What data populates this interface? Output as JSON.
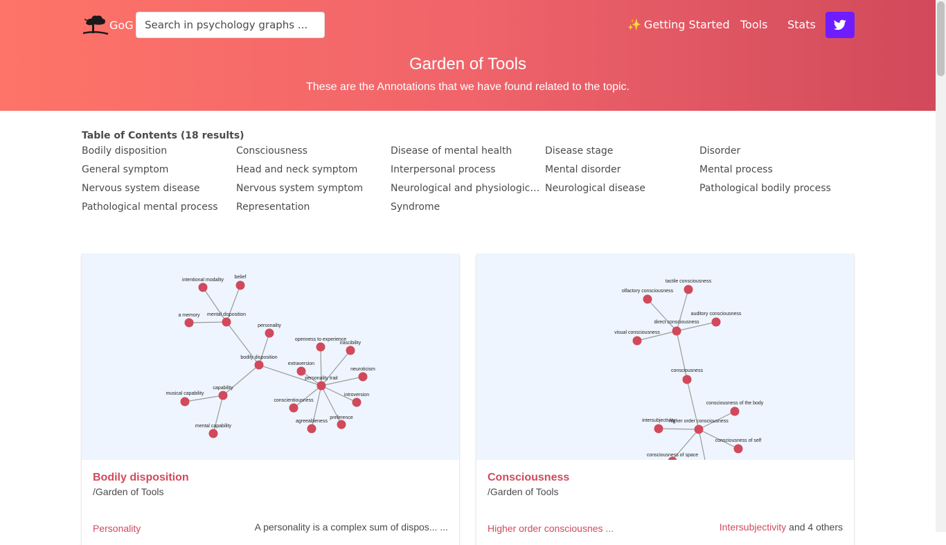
{
  "header": {
    "brand": "GoG",
    "search_placeholder": "Search in psychology graphs ...",
    "nav": {
      "getting_started": "Getting Started",
      "tools": "Tools",
      "stats": "Stats"
    },
    "icons": {
      "logo": "tree-logo-icon",
      "sparkle": "sparkle-icon",
      "twitter": "twitter-icon"
    },
    "sparkle_glyph": "✨"
  },
  "hero": {
    "title": "Garden of Tools",
    "subtitle": "These are the Annotations that we have found related to the topic."
  },
  "toc": {
    "title": "Table of Contents (18 results)",
    "items": [
      "Bodily disposition",
      "Consciousness",
      "Disease of mental health",
      "Disease stage",
      "Disorder",
      "General symptom",
      "Head and neck symptom",
      "Interpersonal process",
      "Mental disorder",
      "Mental process",
      "Nervous system disease",
      "Nervous system symptom",
      "Neurological and physiological s...",
      "Neurological disease",
      "Pathological bodily process",
      "Pathological mental process",
      "Representation",
      "Syndrome"
    ]
  },
  "cards": [
    {
      "title": "Bodily disposition",
      "subtitle": "/Garden of Tools",
      "link": "Personality",
      "right_text": "A personality is a complex sum of dispos... ...",
      "graph": {
        "node_labels": [
          "intentional modality",
          "belief",
          "a memory",
          "mental disposition",
          "personality",
          "bodily disposition",
          "openness to experience",
          "irascibility",
          "extraversion",
          "personality trait",
          "neuroticism",
          "musical capability",
          "capability",
          "conscientiousness",
          "introversion",
          "preference",
          "agreeableness",
          "mental capability"
        ]
      }
    },
    {
      "title": "Consciousness",
      "subtitle": "/Garden of Tools",
      "link": "Higher order consciousnes ...",
      "right_link": "Intersubjectivity",
      "right_text": " and 4 others",
      "graph": {
        "node_labels": [
          "tactile consciousness",
          "olfactory consciousness",
          "auditory consciousness",
          "direct consciousness",
          "visual consciousness",
          "consciousness",
          "consciousness of the body",
          "intersubjectivity",
          "higher order consciousness",
          "consciousness of self",
          "consciousness of space"
        ]
      }
    }
  ],
  "colors": {
    "accent": "#d1495b",
    "node": "#d1495b",
    "edge": "#999999",
    "twitter": "#6f1dff",
    "hero_start": "#fe7468",
    "hero_end": "#d1495b"
  }
}
